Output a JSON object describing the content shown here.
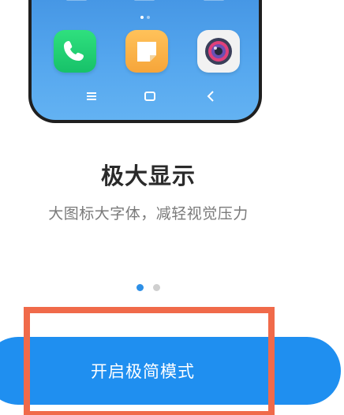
{
  "feature": {
    "title": "极大显示",
    "subtitle": "大图标大字体，减轻视觉压力"
  },
  "carousel": {
    "total": 2,
    "active_index": 0
  },
  "primary_action": {
    "label": "开启极简模式"
  },
  "phone_preview": {
    "apps": [
      {
        "icon": "phone-icon"
      },
      {
        "icon": "notes-icon"
      },
      {
        "icon": "camera-icon"
      }
    ],
    "nav_buttons": [
      "menu-icon",
      "home-icon",
      "back-icon"
    ]
  },
  "colors": {
    "accent": "#1f8ff0",
    "highlight": "#f06a4a",
    "title": "#2a2a2a",
    "subtitle": "#7a7a7a"
  }
}
